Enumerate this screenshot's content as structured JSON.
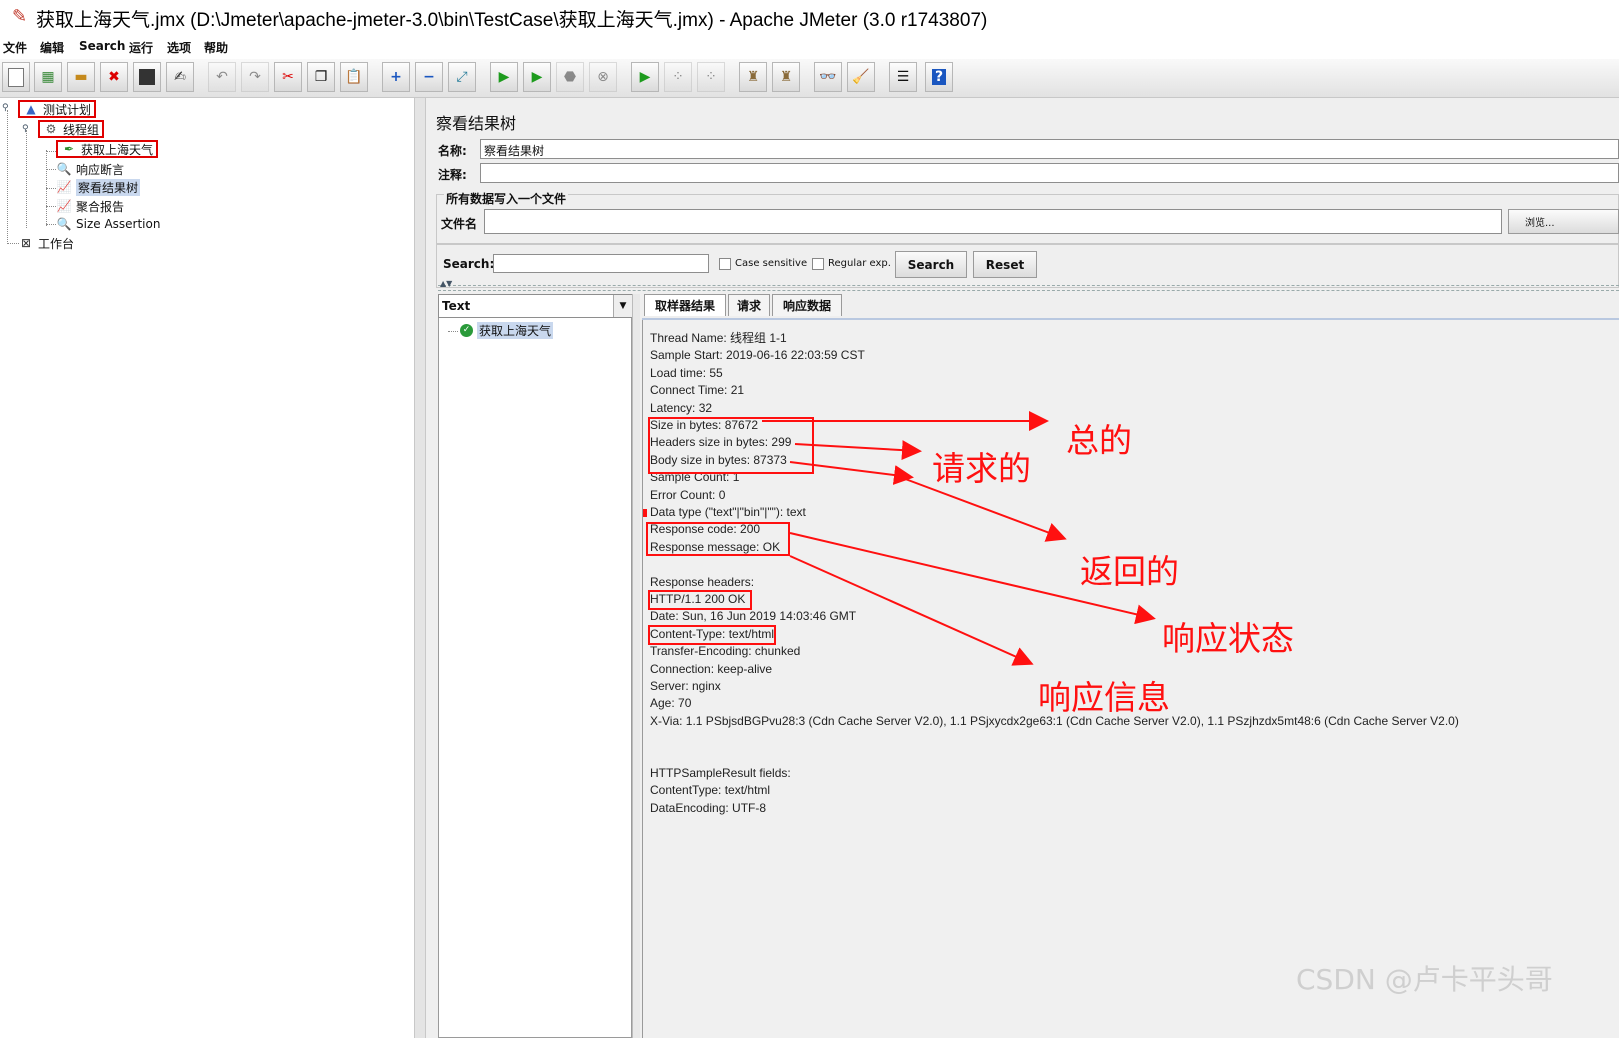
{
  "window": {
    "title": "获取上海天气.jmx (D:\\Jmeter\\apache-jmeter-3.0\\bin\\TestCase\\获取上海天气.jmx) - Apache JMeter (3.0 r1743807)"
  },
  "menu": [
    "文件",
    "编辑",
    "Search",
    "运行",
    "选项",
    "帮助"
  ],
  "toolbar": [
    "new-icon",
    "templates-icon",
    "open-icon",
    "close-icon",
    "save-icon",
    "save-as-icon",
    "undo-icon",
    "redo-icon",
    "cut-icon",
    "copy-icon",
    "paste-icon",
    "expand-icon",
    "collapse-icon",
    "toggle-icon",
    "start-icon",
    "start-no-pause-icon",
    "stop-icon",
    "shutdown-icon",
    "remote-start-icon",
    "remote-stop-icon",
    "remote-shutdown-icon",
    "clear-icon",
    "clear-all-icon",
    "search-icon",
    "reset-search-icon",
    "function-helper-icon",
    "help-icon"
  ],
  "tree": {
    "test_plan": "测试计划",
    "thread_group": "线程组",
    "sampler": "获取上海天气",
    "assertion": "响应断言",
    "results_tree": "察看结果树",
    "aggregate": "聚合报告",
    "size_assertion": "Size Assertion",
    "workbench": "工作台"
  },
  "panel": {
    "title": "察看结果树",
    "name_label": "名称:",
    "name_value": "察看结果树",
    "comment_label": "注释:",
    "file_section": "所有数据写入一个文件",
    "filename_label": "文件名",
    "browse_label": "浏览...",
    "search_label": "Search:",
    "case_sensitive": "Case sensitive",
    "regular_exp": "Regular exp.",
    "search_button": "Search",
    "reset_button": "Reset",
    "renderer": "Text",
    "result_item": "获取上海天气",
    "tabs": [
      "取样器结果",
      "请求",
      "响应数据"
    ]
  },
  "result_lines": [
    "Thread Name: 线程组 1-1",
    "Sample Start: 2019-06-16 22:03:59 CST",
    "Load time: 55",
    "Connect Time: 21",
    "Latency: 32",
    "Size in bytes: 87672",
    "Headers size in bytes: 299",
    "Body size in bytes: 87373",
    "Sample Count: 1",
    "Error Count: 0",
    "Data type (\"text\"|\"bin\"|\"\"): text",
    "Response code: 200",
    "Response message: OK",
    "",
    "Response headers:",
    "HTTP/1.1 200 OK",
    "Date: Sun, 16 Jun 2019 14:03:46 GMT",
    "Content-Type: text/html",
    "Transfer-Encoding: chunked",
    "Connection: keep-alive",
    "Server: nginx",
    "Age: 70",
    "X-Via: 1.1 PSbjsdBGPvu28:3 (Cdn Cache Server V2.0), 1.1 PSjxycdx2ge63:1 (Cdn Cache Server V2.0), 1.1 PSzjhzdx5mt48:6 (Cdn Cache Server V2.0)",
    "",
    "",
    "HTTPSampleResult fields:",
    "ContentType: text/html",
    "DataEncoding: UTF-8"
  ],
  "annotations": {
    "total": "总的",
    "request": "请求的",
    "returned": "返回的",
    "status": "响应状态",
    "info": "响应信息",
    "color": "#ff1010"
  },
  "watermark": "CSDN @卢卡平头哥"
}
